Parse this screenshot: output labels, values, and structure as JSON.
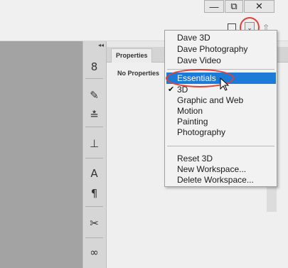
{
  "window": {
    "minimize_glyph": "—",
    "restore_glyph": "⧉",
    "close_glyph": "✕"
  },
  "tools": [
    {
      "icon": "history-brush-icon",
      "glyph": "8"
    },
    {
      "icon": "brush-icon",
      "glyph": "✎"
    },
    {
      "icon": "adjustments-icon",
      "glyph": "≛"
    },
    {
      "icon": "stamp-icon",
      "glyph": "⊥"
    },
    {
      "icon": "character-icon",
      "glyph": "A"
    },
    {
      "icon": "paragraph-icon",
      "glyph": "¶"
    },
    {
      "icon": "scissors-icon",
      "glyph": "✂"
    },
    {
      "icon": "creative-cloud-icon",
      "glyph": "∞"
    }
  ],
  "panel": {
    "tab_label": "Properties",
    "empty_text": "No Properties"
  },
  "workspace_menu": {
    "group1": [
      "Dave 3D",
      "Dave Photography",
      "Dave Video"
    ],
    "group2": [
      "Essentials",
      "3D",
      "Graphic and Web",
      "Motion",
      "Painting",
      "Photography"
    ],
    "group3": [
      "Reset 3D",
      "New Workspace...",
      "Delete Workspace..."
    ],
    "highlighted": "Essentials",
    "checked": "3D",
    "check_glyph": "✔"
  },
  "colors": {
    "highlight": "#1b7bd6",
    "callout_ring": "#e2403a"
  }
}
